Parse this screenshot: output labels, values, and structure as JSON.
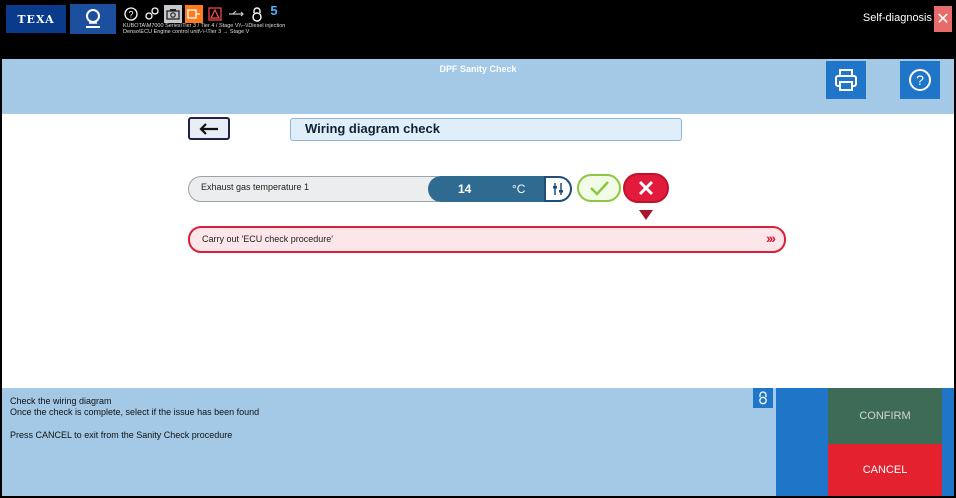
{
  "topbar": {
    "logo": "TEXA",
    "vehicle_path_line1": "KUBOTA\\M7000 Series\\Tier 3 / Tier 4 / Stage V\\\\--\\\\Diesel injection",
    "vehicle_path_line2": "Denso\\ECU Engine control unit\\-\\-\\Tier 3 → Stage V",
    "badge_count": "5",
    "mode_label": "Self-diagnosis"
  },
  "header": {
    "title": "DPF Sanity Check"
  },
  "main": {
    "step_title": "Wiring diagram check",
    "parameter": {
      "name": "Exhaust gas temperature 1",
      "value": "14",
      "unit": "°C"
    },
    "action": {
      "label": "Carry out 'ECU check procedure'",
      "arrows": "›››"
    }
  },
  "bottom": {
    "message_line1": "Check the wiring diagram",
    "message_line2": "Once the check is complete, select if the issue has been found",
    "message_line3": "Press CANCEL to exit from the Sanity Check procedure",
    "confirm_label": "CONFIRM",
    "cancel_label": "CANCEL"
  },
  "colors": {
    "header_bg": "#a3c9e6",
    "accent_blue": "#1f76c9",
    "confirm_bg": "#3e6b55",
    "cancel_bg": "#e4212f",
    "ok_green": "#8dc63f",
    "ko_red": "#e21b3c"
  }
}
